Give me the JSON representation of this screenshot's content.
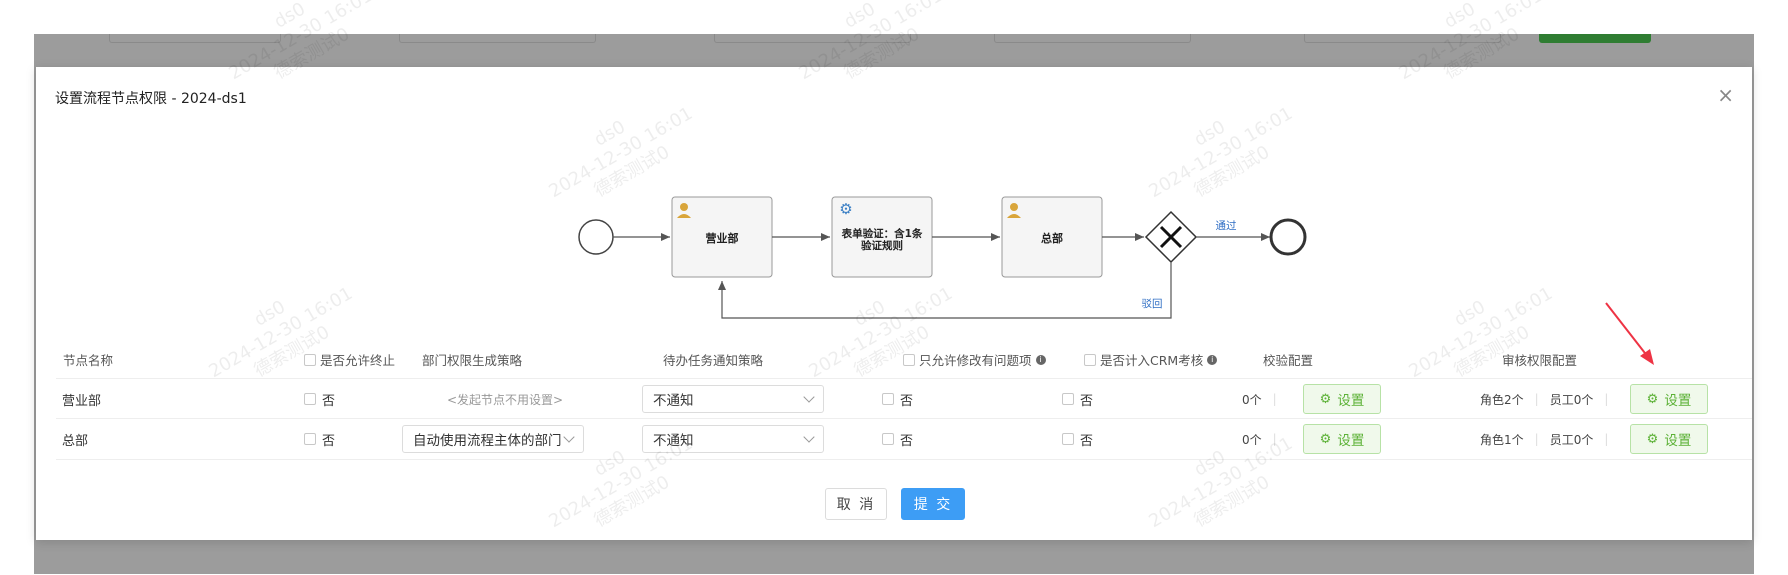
{
  "dialog": {
    "title": "设置流程节点权限 - 2024-ds1",
    "close_glyph": "×"
  },
  "flow": {
    "nodes": [
      {
        "label": "营业部",
        "icon": "user-icon"
      },
      {
        "label_line1": "表单验证：含1条",
        "label_line2": "验证规则",
        "icon": "gear-icon"
      },
      {
        "label": "总部",
        "icon": "user-icon"
      }
    ],
    "gateway_pass_label": "通过",
    "gateway_reject_label": "驳回"
  },
  "table": {
    "headers": {
      "node_name": "节点名称",
      "allow_terminate": "是否允许终止",
      "dept_strategy": "部门权限生成策略",
      "notify_strategy": "待办任务通知策略",
      "only_modify_issues": "只允许修改有问题项",
      "crm_assessment": "是否计入CRM考核",
      "validation_config": "校验配置",
      "audit_config": "审核权限配置"
    },
    "rows": [
      {
        "node_name": "营业部",
        "allow_terminate": "否",
        "dept_strategy_placeholder": "<发起节点不用设置>",
        "notify": "不通知",
        "only_modify": "否",
        "crm": "否",
        "validation_count": "0个",
        "validation_button": "设置",
        "role_count": "角色2个",
        "staff_count": "员工0个",
        "audit_button": "设置"
      },
      {
        "node_name": "总部",
        "allow_terminate": "否",
        "dept_strategy": "自动使用流程主体的部门",
        "notify": "不通知",
        "only_modify": "否",
        "crm": "否",
        "validation_count": "0个",
        "validation_button": "设置",
        "role_count": "角色1个",
        "staff_count": "员工0个",
        "audit_button": "设置"
      }
    ]
  },
  "footer": {
    "cancel_label": "取 消",
    "submit_label": "提 交"
  },
  "watermark": {
    "line1": "ds0",
    "line2": "2024-12-30 16:01",
    "line3": "德索测试0"
  },
  "colors": {
    "primary": "#3d9df5",
    "success_text": "#5bb135",
    "success_bg": "#f0f9eb",
    "annotation_arrow": "#ee3344"
  }
}
